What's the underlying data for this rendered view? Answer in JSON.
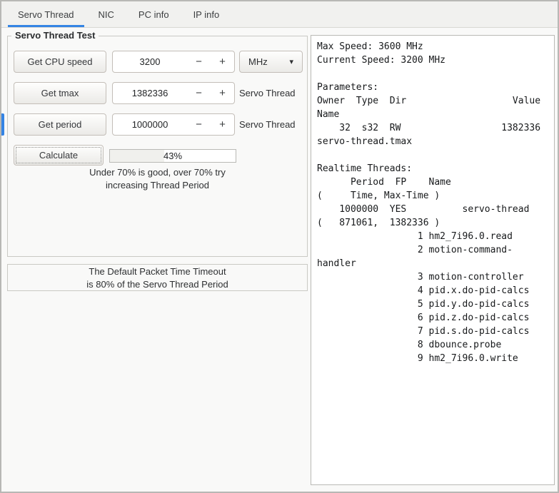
{
  "colors": {
    "accent": "#3584e4"
  },
  "icons": {
    "minus": "−",
    "plus": "+",
    "dropdown": "▾"
  },
  "tabs": [
    {
      "label": "Servo Thread",
      "active": true
    },
    {
      "label": "NIC",
      "active": false
    },
    {
      "label": "PC info",
      "active": false
    },
    {
      "label": "IP info",
      "active": false
    }
  ],
  "servo_test": {
    "title": "Servo Thread Test",
    "rows": [
      {
        "button": "Get CPU speed",
        "value": "3200",
        "unit": "MHz"
      },
      {
        "button": "Get tmax",
        "value": "1382336",
        "label": "Servo Thread"
      },
      {
        "button": "Get period",
        "value": "1000000",
        "label": "Servo Thread"
      }
    ],
    "calculate_button": "Calculate",
    "progress": {
      "percent": 43,
      "label": "43%"
    },
    "hint": [
      "Under 70% is good, over 70% try",
      "increasing Thread Period"
    ]
  },
  "timeout_note": [
    "The Default Packet Time Timeout",
    "is 80% of the Servo Thread Period"
  ],
  "output": {
    "lines": [
      "Max Speed: 3600 MHz",
      "Current Speed: 3200 MHz",
      "",
      "Parameters:",
      "Owner  Type  Dir                   Value",
      "Name",
      "    32  s32  RW                  1382336",
      "servo-thread.tmax",
      "",
      "Realtime Threads:",
      "      Period  FP    Name",
      "(     Time, Max-Time )",
      "    1000000  YES          servo-thread",
      "(   871061,  1382336 )",
      "                  1 hm2_7i96.0.read",
      "                  2 motion-command-",
      "handler",
      "                  3 motion-controller",
      "                  4 pid.x.do-pid-calcs",
      "                  5 pid.y.do-pid-calcs",
      "                  6 pid.z.do-pid-calcs",
      "                  7 pid.s.do-pid-calcs",
      "                  8 dbounce.probe",
      "                  9 hm2_7i96.0.write"
    ]
  }
}
